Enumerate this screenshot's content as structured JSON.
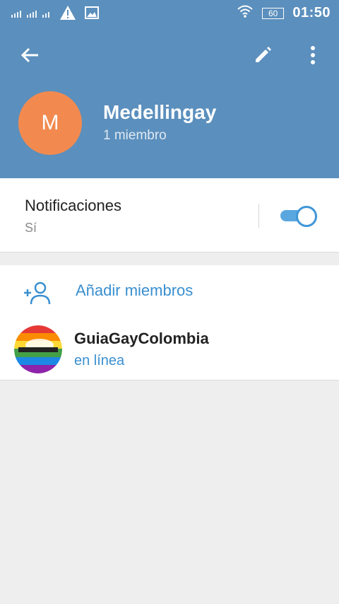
{
  "status_bar": {
    "battery": "60",
    "time": "01:50"
  },
  "toolbar": {
    "back_icon": "arrow-left-icon",
    "edit_icon": "pencil-icon",
    "more_icon": "more-vertical-icon"
  },
  "group": {
    "avatar_letter": "M",
    "avatar_color": "#f28a50",
    "name": "Medellingay",
    "members_count": "1 miembro"
  },
  "notifications": {
    "title": "Notificaciones",
    "value": "Sí",
    "enabled": true
  },
  "members": {
    "add_label": "Añadir miembros",
    "list": [
      {
        "name": "GuiaGayColombia",
        "status": "en línea"
      }
    ]
  },
  "colors": {
    "header": "#5b8fbd",
    "accent": "#3a8fd0",
    "background": "#eeeeee"
  }
}
